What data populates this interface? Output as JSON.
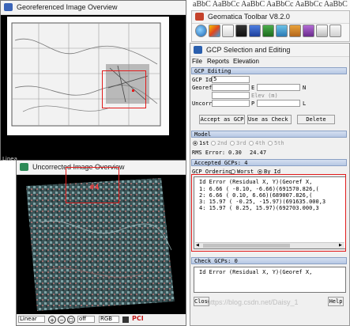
{
  "top_strip": {
    "text": "aBbC AaBbCc AaBbC AaBbCc AaBbCc AaBbC"
  },
  "georef_window": {
    "title": "Georeferenced Image Overview",
    "linear": "Linea"
  },
  "toolbar_window": {
    "title": "Geomatica Toolbar V8.2.0"
  },
  "uncorrected_window": {
    "title": "Uncorrected Image Overview",
    "marker": "#4",
    "linear_select": "Linear",
    "off_select": "off",
    "rgb_select": "RGB",
    "pci_label": "PCI"
  },
  "gcp_window": {
    "title": "GCP Selection and Editing",
    "menu": [
      "File",
      "Reports",
      "Elevation"
    ],
    "editing_header": "GCP Editing",
    "gcp_id_label": "GCP Id:",
    "gcp_id_value": "5",
    "georef_label": "Georef:",
    "e_label": "E",
    "n_label": "N",
    "elev_label": "Elev (m)",
    "uncorr_label": "Uncorr:",
    "p_label": "P",
    "l_label": "L",
    "accept_gcp": "Accept as GCP",
    "use_check": "Use as Check Pt",
    "delete": "Delete",
    "model_header": "Model",
    "model_options": [
      "1st",
      "2nd",
      "3rd",
      "4th",
      "5th"
    ],
    "rms_label": "RMS Error:",
    "rms_x": "0.30",
    "rms_y": "24.47",
    "accepted_header": "Accepted GCPs: 4",
    "ordering_label": "GCP Ordering:",
    "worst_label": "Worst",
    "byid_label": "By Id",
    "table_header": "Id  Error (Residual X,   Y)(Georef   X,",
    "rows": [
      "1:  6.66 (  -0.10,  -6.66)(691570.826,(",
      "2:  6.66 (   0.10,   6.66)(689007.826,(",
      "3: 15.97 (  -0.25, -15.97)(691635.000,3",
      "4: 15.97 (   0.25,  15.97)(692703.000,3"
    ],
    "check_header": "Check GCPs: 0",
    "check_table_header": "Id  Error (Residual X,   Y)(Georef   X,",
    "close": "Close",
    "help": "Help"
  },
  "watermark": "https://blog.csdn.net/Daisy_1"
}
